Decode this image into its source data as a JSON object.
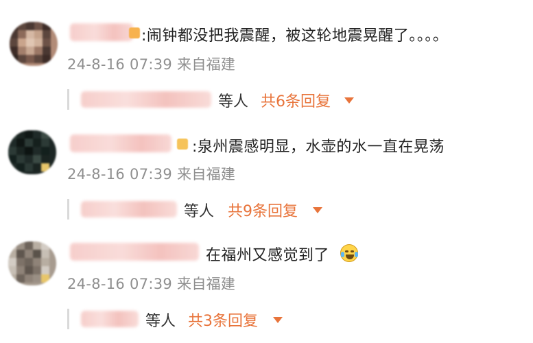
{
  "comments": [
    {
      "text": ":闹钟都没把我震醒，被这轮地震晃醒了。。。。",
      "meta": "24-8-16 07:39 来自福建",
      "reply_suffix": "等人",
      "reply_count": "共6条回复",
      "avatar_colors": [
        "#4b3a35",
        "#7a5a4d",
        "#c9a48c",
        "#3a2d28"
      ]
    },
    {
      "text": ":泉州震感明显，水壶的水一直在晃荡",
      "meta": "24-8-16 07:39 来自福建",
      "reply_suffix": "等人",
      "reply_count": "共9条回复",
      "avatar_colors": [
        "#1f2a28",
        "#2c3a36",
        "#13201d",
        "#3b4a44"
      ]
    },
    {
      "text": "在福州又感觉到了",
      "meta": "24-8-16 07:39 来自福建",
      "reply_suffix": "等人",
      "reply_count": "共3条回复",
      "avatar_colors": [
        "#8f8378",
        "#b8aea2",
        "#6e645b",
        "#d3ccc4"
      ]
    }
  ],
  "colors": {
    "accent": "#e8743b",
    "meta_text": "#8f8f8f",
    "body_text": "#222222"
  },
  "icons": {
    "caret": "chevron-down-icon",
    "badge": "vip-badge-icon",
    "emoji": "laugh-cry-emoji-icon"
  }
}
